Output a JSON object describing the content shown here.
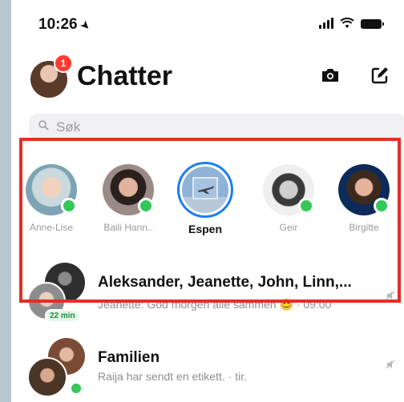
{
  "status": {
    "time": "10:26"
  },
  "header": {
    "title": "Chatter",
    "badge": "1"
  },
  "search": {
    "placeholder": "Søk"
  },
  "stories": [
    {
      "name": "Anne-Lise"
    },
    {
      "name": "Baili Hann.."
    },
    {
      "name": "Espen"
    },
    {
      "name": "Geir"
    },
    {
      "name": "Birgitte"
    }
  ],
  "chats": [
    {
      "title": "Aleksander, Jeanette, John, Linn,...",
      "preview": "Jeanette: God morgen alle sammen 😊 · 09:00",
      "badge": "22 min"
    },
    {
      "title": "Familien",
      "preview": "Raija har sendt en etikett. · tir."
    }
  ],
  "colors": {
    "accent": "#1b7ef2",
    "online": "#34c759",
    "badge": "#ff3b30",
    "highlight": "#e32e25"
  }
}
